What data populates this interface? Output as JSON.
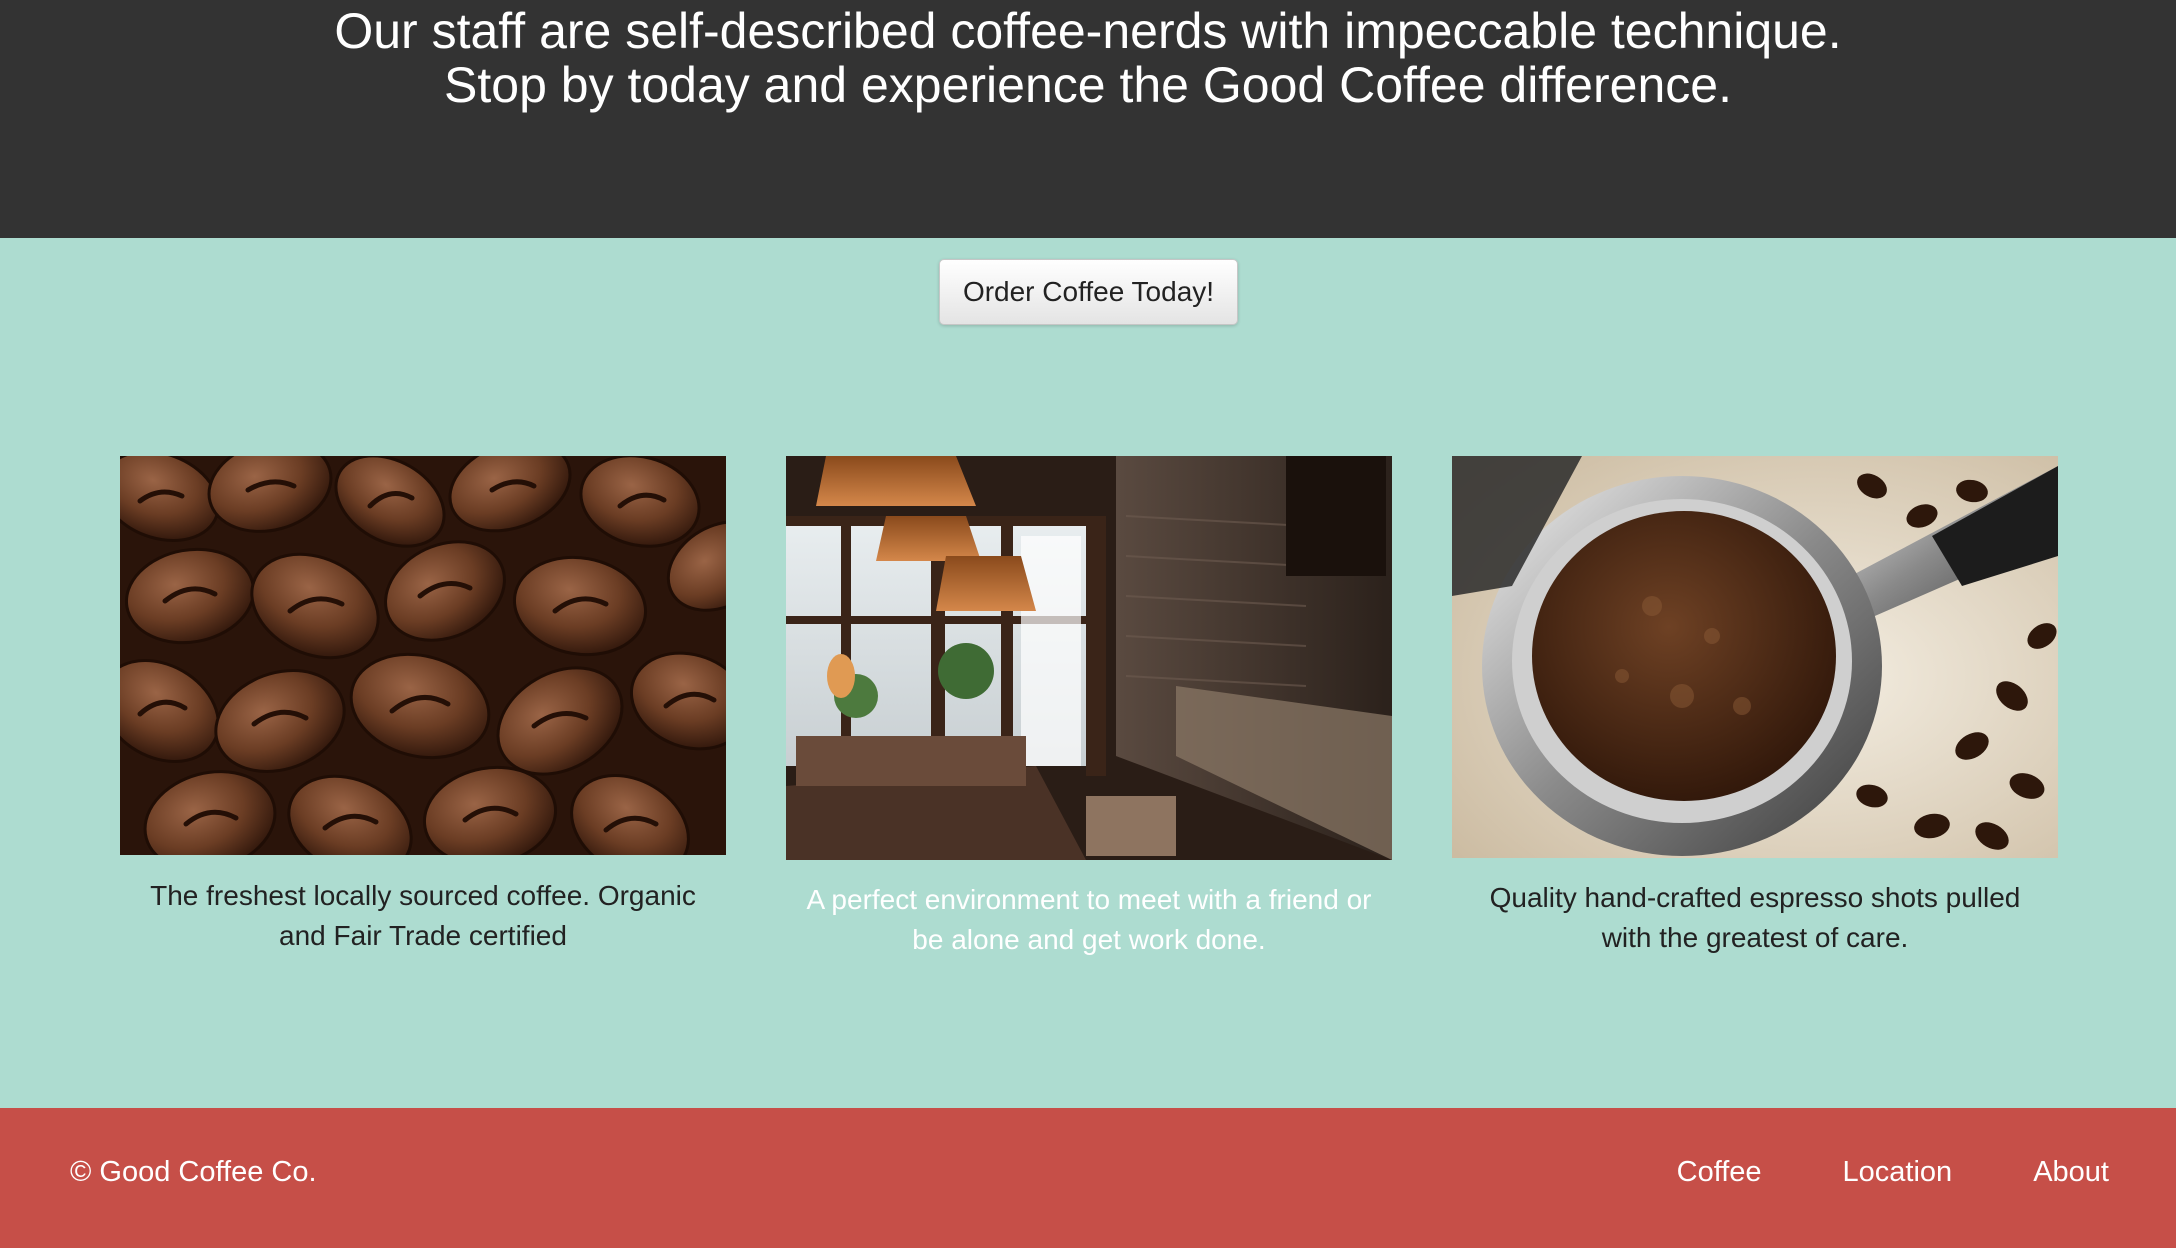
{
  "hero": {
    "line1": "Our staff are self-described coffee-nerds with impeccable technique.",
    "line2": "Stop by today and experience the Good Coffee difference."
  },
  "order_button": {
    "label": "Order Coffee Today!"
  },
  "features": [
    {
      "image": "coffee-beans-photo",
      "caption": "The freshest locally sourced coffee. Organic and Fair Trade certified"
    },
    {
      "image": "cafe-interior-photo",
      "caption": "A perfect environment to meet with a friend or be alone and get work done."
    },
    {
      "image": "espresso-portafilter-photo",
      "caption": "Quality hand-crafted espresso shots pulled with the greatest of care."
    }
  ],
  "footer": {
    "brand": "© Good Coffee Co.",
    "nav": [
      "Coffee",
      "Location",
      "About"
    ]
  },
  "colors": {
    "hero_background": "#333333",
    "page_background": "#addcd0",
    "footer_background": "#c64f48",
    "text_light": "#ffffff",
    "text_dark": "#222222"
  }
}
